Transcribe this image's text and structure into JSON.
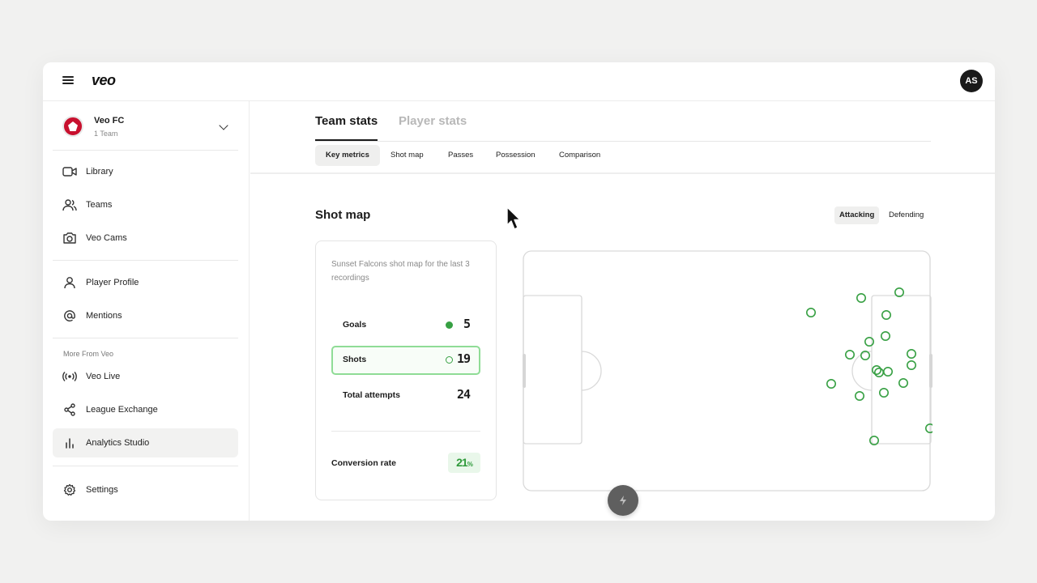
{
  "app": {
    "logo": "veo",
    "avatar_initials": "AS"
  },
  "team": {
    "name": "Veo FC",
    "subtitle": "1 Team"
  },
  "sidebar": {
    "items": [
      {
        "label": "Library",
        "icon": "video-icon"
      },
      {
        "label": "Teams",
        "icon": "users-icon"
      },
      {
        "label": "Veo Cams",
        "icon": "camera-icon"
      },
      {
        "label": "Player Profile",
        "icon": "user-icon"
      },
      {
        "label": "Mentions",
        "icon": "at-icon"
      }
    ],
    "section_label": "More From Veo",
    "more_items": [
      {
        "label": "Veo Live",
        "icon": "broadcast-icon"
      },
      {
        "label": "League Exchange",
        "icon": "share-icon"
      },
      {
        "label": "Analytics Studio",
        "icon": "bar-chart-icon",
        "active": true
      }
    ],
    "bottom_items": [
      {
        "label": "Settings",
        "icon": "gear-icon"
      }
    ]
  },
  "tabs": [
    {
      "label": "Team stats",
      "active": true
    },
    {
      "label": "Player stats",
      "active": false
    }
  ],
  "subtabs": [
    {
      "label": "Key metrics",
      "active": true
    },
    {
      "label": "Shot map",
      "active": false
    },
    {
      "label": "Passes",
      "active": false
    },
    {
      "label": "Possession",
      "active": false
    },
    {
      "label": "Comparison",
      "active": false
    }
  ],
  "shot_map": {
    "title": "Shot map",
    "toggle": {
      "attacking": "Attacking",
      "defending": "Defending",
      "active": "Attacking"
    },
    "description": "Sunset Falcons shot map for the last 3 recordings",
    "stats": {
      "goals": {
        "label": "Goals",
        "value": "5"
      },
      "shots": {
        "label": "Shots",
        "value": "19"
      },
      "total": {
        "label": "Total attempts",
        "value": "24"
      }
    },
    "conversion": {
      "label": "Conversion rate",
      "value": "21",
      "unit": "%"
    }
  },
  "colors": {
    "accent_green": "#37a043",
    "highlight_border": "#8fdc96"
  }
}
